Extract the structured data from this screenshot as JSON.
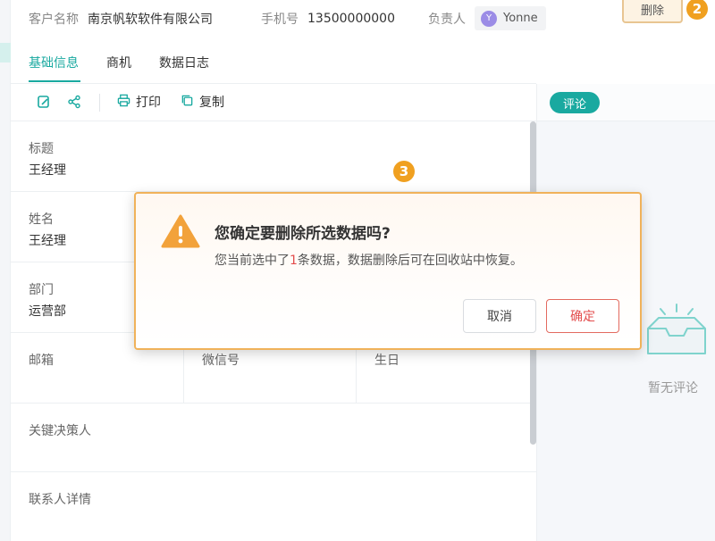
{
  "header": {
    "customer_label": "客户名称",
    "customer_value": "南京帆软软件有限公司",
    "phone_label": "手机号",
    "phone_value": "13500000000",
    "owner_label": "负责人",
    "owner_initial": "Y",
    "owner_name": "Yonne",
    "delete_label": "删除",
    "delete_step": "2"
  },
  "tabs": [
    {
      "label": "基础信息",
      "active": true
    },
    {
      "label": "商机",
      "active": false
    },
    {
      "label": "数据日志",
      "active": false
    }
  ],
  "toolbar": {
    "print_label": "打印",
    "copy_label": "复制"
  },
  "fields": {
    "title_label": "标题",
    "title_value": "王经理",
    "name_label": "姓名",
    "name_value": "王经理",
    "dept_label": "部门",
    "dept_value": "运营部",
    "email_label": "邮箱",
    "wechat_label": "微信号",
    "birthday_label": "生日",
    "decision_label": "关键决策人",
    "contact_detail_label": "联系人详情"
  },
  "comments": {
    "tab_label": "评论",
    "empty_text": "暂无评论"
  },
  "dialog": {
    "step": "3",
    "title": "您确定要删除所选数据吗?",
    "msg_prefix": "您当前选中了",
    "msg_count": "1",
    "msg_suffix": "条数据，数据删除后可在回收站中恢复。",
    "cancel_label": "取消",
    "confirm_label": "确定"
  },
  "colors": {
    "accent": "#19a9a0",
    "danger": "#e34d4d",
    "highlight_border": "#f0b25a",
    "step_badge": "#f0a020"
  },
  "icons": {
    "edit": "edit-icon",
    "share": "share-icon",
    "print": "printer-icon",
    "copy": "copy-icon",
    "warning": "warning-icon"
  }
}
